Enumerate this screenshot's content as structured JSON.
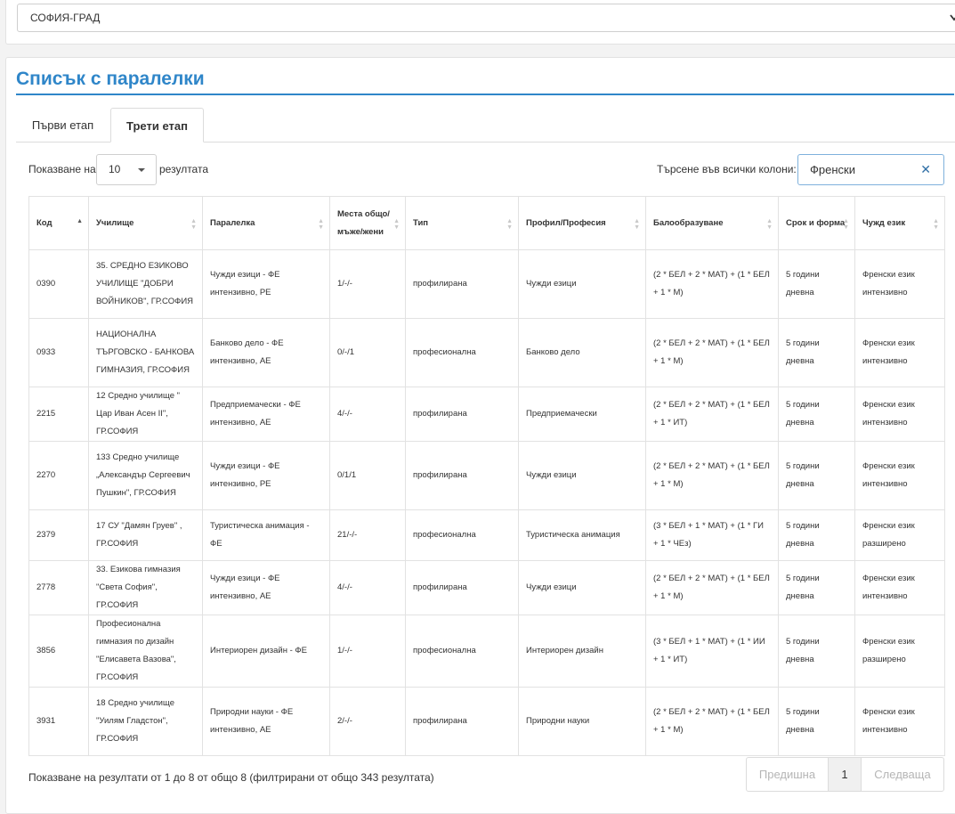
{
  "region": {
    "value": "СОФИЯ-ГРАД"
  },
  "page": {
    "title": "Списък с паралелки"
  },
  "tabs": [
    {
      "label": "Първи етап"
    },
    {
      "label": "Трети етап"
    }
  ],
  "length": {
    "label_before": "Показване на",
    "value": "10",
    "label_after": "резултата"
  },
  "search": {
    "label": "Търсене във всички колони:",
    "value": "Френски"
  },
  "columns": [
    "Код",
    "Училище",
    "Паралелка",
    "Места общо/ мъже/жени",
    "Тип",
    "Профил/Професия",
    "Балообразуване",
    "Срок и форма",
    "Чужд език"
  ],
  "rows": [
    [
      "0390",
      "35. СРЕДНО ЕЗИКОВО УЧИЛИЩЕ \"ДОБРИ ВОЙНИКОВ\", ГР.СОФИЯ",
      "Чужди езици - ФЕ интензивно, РЕ",
      "1/-/-",
      "профилирана",
      "Чужди езици",
      "(2 * БЕЛ + 2 * МАТ) + (1 * БЕЛ + 1 * М)",
      "5 години дневна",
      "Френски език интензивно"
    ],
    [
      "0933",
      "НАЦИОНАЛНА ТЪРГОВСКО - БАНКОВА ГИМНАЗИЯ, ГР.СОФИЯ",
      "Банково дело - ФЕ интензивно, АЕ",
      "0/-/1",
      "професионална",
      "Банково дело",
      "(2 * БЕЛ + 2 * МАТ) + (1 * БЕЛ + 1 * М)",
      "5 години дневна",
      "Френски език интензивно"
    ],
    [
      "2215",
      "12 Средно училище \" Цар Иван Асен II\", ГР.СОФИЯ",
      "Предприемачески - ФЕ интензивно, АЕ",
      "4/-/-",
      "профилирана",
      "Предприемачески",
      "(2 * БЕЛ + 2 * МАТ) + (1 * БЕЛ + 1 * ИТ)",
      "5 години дневна",
      "Френски език интензивно"
    ],
    [
      "2270",
      "133 Средно училище „Александър Сергеевич Пушкин\", ГР.СОФИЯ",
      "Чужди езици - ФЕ интензивно, РЕ",
      "0/1/1",
      "профилирана",
      "Чужди езици",
      "(2 * БЕЛ + 2 * МАТ) + (1 * БЕЛ + 1 * М)",
      "5 години дневна",
      "Френски език интензивно"
    ],
    [
      "2379",
      "17 СУ \"Дамян Груев\" , ГР.СОФИЯ",
      "Туристическа анимация - ФЕ",
      "21/-/-",
      "професионална",
      "Туристическа анимация",
      "(3 * БЕЛ + 1 * МАТ) + (1 * ГИ + 1 * ЧЕз)",
      "5 години дневна",
      "Френски език разширено"
    ],
    [
      "2778",
      "33. Езикова гимназия \"Света София\", ГР.СОФИЯ",
      "Чужди езици - ФЕ интензивно, АЕ",
      "4/-/-",
      "профилирана",
      "Чужди езици",
      "(2 * БЕЛ + 2 * МАТ) + (1 * БЕЛ + 1 * М)",
      "5 години дневна",
      "Френски език интензивно"
    ],
    [
      "3856",
      "Професионална гимназия по дизайн \"Елисавета Вазова\", ГР.СОФИЯ",
      "Интериорен дизайн - ФЕ",
      "1/-/-",
      "професионална",
      "Интериорен дизайн",
      "(3 * БЕЛ + 1 * МАТ) + (1 * ИИ + 1 * ИТ)",
      "5 години дневна",
      "Френски език разширено"
    ],
    [
      "3931",
      "18 Средно училище \"Уилям Гладстон\", ГР.СОФИЯ",
      "Природни науки - ФЕ интензивно, АЕ",
      "2/-/-",
      "профилирана",
      "Природни науки",
      "(2 * БЕЛ + 2 * МАТ) + (1 * БЕЛ + 1 * М)",
      "5 години дневна",
      "Френски език интензивно"
    ]
  ],
  "info": "Показване на резултати от 1 до 8 от общо 8 (филтрирани от общо 343 резултата)",
  "pagination": {
    "prev": "Предишна",
    "current": "1",
    "next": "Следваща"
  }
}
